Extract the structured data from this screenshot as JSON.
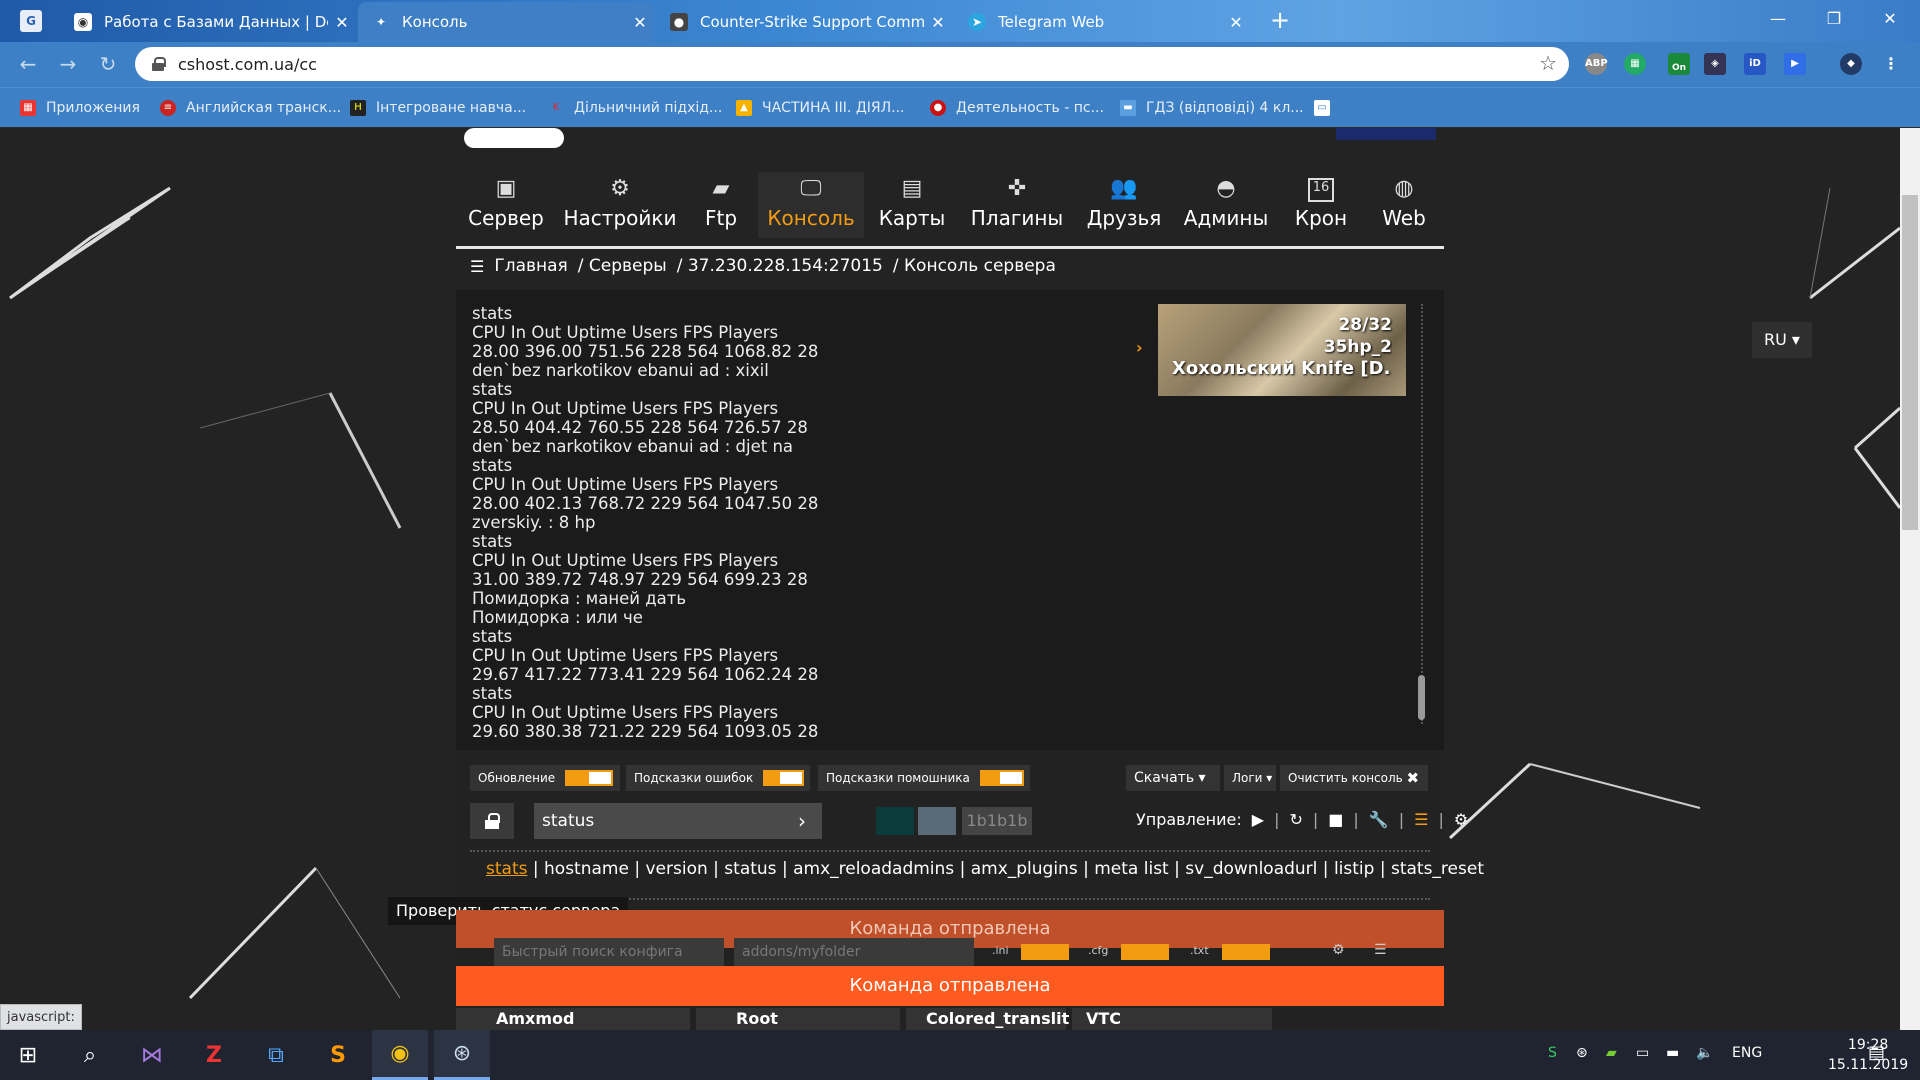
{
  "browser": {
    "tabs": [
      {
        "title": "Работа с Базами Данных | Dev-C",
        "active": false
      },
      {
        "title": "Консоль",
        "active": true
      },
      {
        "title": "Counter-Strike Support Commun",
        "active": false
      },
      {
        "title": "Telegram Web",
        "active": false
      }
    ],
    "url": "cshost.com.ua/cc",
    "bookmarks": [
      "Приложения",
      "Английская транск...",
      "Інтегроване навча...",
      "Дільничний підхід...",
      "ЧАСТИНА III. ДІЯЛ...",
      "Деятельность - пс...",
      "ГДЗ (відповіді) 4 кл..."
    ],
    "extensions": {
      "abp": "ABP",
      "on": "On"
    }
  },
  "menu": [
    {
      "label": "Сервер",
      "icon": "monitor-icon"
    },
    {
      "label": "Настройки",
      "icon": "gears-icon"
    },
    {
      "label": "Ftp",
      "icon": "folder-icon"
    },
    {
      "label": "Консоль",
      "icon": "console-icon",
      "active": true
    },
    {
      "label": "Карты",
      "icon": "film-icon"
    },
    {
      "label": "Плагины",
      "icon": "puzzle-icon"
    },
    {
      "label": "Друзья",
      "icon": "friends-icon"
    },
    {
      "label": "Админы",
      "icon": "cap-icon"
    },
    {
      "label": "Крон",
      "icon": "calendar-icon"
    },
    {
      "label": "Web",
      "icon": "globe-icon"
    }
  ],
  "calendar_day": "16",
  "breadcrumb": [
    "Главная",
    "/ Серверы",
    "/ 37.230.228.154:27015",
    "/ Консоль сервера"
  ],
  "console_lines": [
    "stats",
    "CPU In Out Uptime Users FPS Players",
    "28.00 396.00 751.56 228 564 1068.82 28",
    "den`bez narkotikov ebanui ad : xixil",
    "stats",
    "CPU In Out Uptime Users FPS Players",
    "28.50 404.42 760.55 228 564 726.57 28",
    "den`bez narkotikov ebanui ad : djet na",
    "stats",
    "CPU In Out Uptime Users FPS Players",
    "28.00 402.13 768.72 229 564 1047.50 28",
    "zverskiy. : 8 hp",
    "stats",
    "CPU In Out Uptime Users FPS Players",
    "31.00 389.72 748.97 229 564 699.23 28",
    "Помидорка : маней дать",
    "Помидорка : или че",
    "stats",
    "CPU In Out Uptime Users FPS Players",
    "29.67 417.22 773.41 229 564 1062.24 28",
    "stats",
    "CPU In Out Uptime Users FPS Players",
    "29.60 380.38 721.22 229 564 1093.05 28"
  ],
  "server_card": {
    "players": "28/32",
    "map": "35hp_2",
    "name": "Хохольский Knife [D..."
  },
  "toggles": {
    "update": "Обновление",
    "error_hints": "Подсказки ошибок",
    "helper_hints": "Подсказки помошника"
  },
  "download": "Скачать",
  "logs": "Логи",
  "clear_console": "Очистить консоль",
  "command": {
    "value": "status",
    "color_hex": "1b1b1b"
  },
  "colors": {
    "c1": "#222222",
    "c2": "#0b3b3b",
    "c3": "#5a6a78",
    "accent": "#f39c12",
    "notify": "#ff5a1f"
  },
  "management_label": "Управление:",
  "quick_commands": [
    "stats",
    "hostname",
    "version",
    "status",
    "amx_reloadadmins",
    "amx_plugins",
    "meta list",
    "sv_downloadurl",
    "listip",
    "stats_reset"
  ],
  "tooltip": "Проверить статус сервера",
  "notification": "Команда отправлена",
  "config_search_placeholder": "Быстрый поиск конфига",
  "folder_placeholder": "addons/myfolder",
  "ext_ini": ".ini",
  "ext_cfg": ".cfg",
  "ext_txt": ".txt",
  "config_tabs": [
    "Amxmod",
    "Root",
    "Colored_translit",
    "VTC"
  ],
  "language": "RU",
  "status_bar": "javascript:",
  "taskbar": {
    "lang": "ENG",
    "time": "19:28",
    "date": "15.11.2019"
  }
}
